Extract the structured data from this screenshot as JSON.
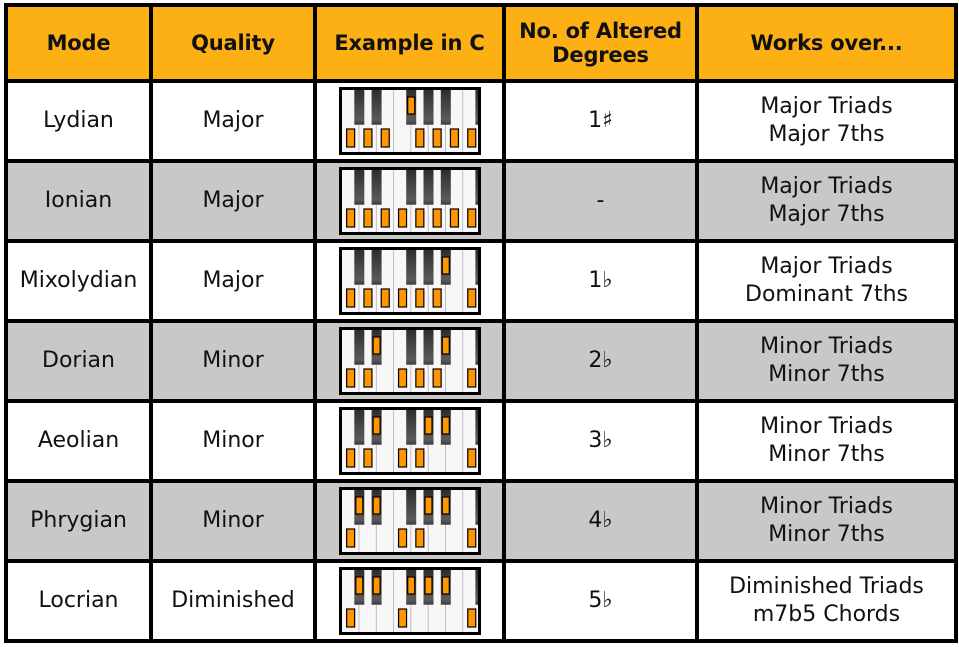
{
  "table": {
    "headers": [
      "Mode",
      "Quality",
      "Example in C",
      "No. of Altered Degrees",
      "Works over..."
    ],
    "header_fill": "#fdb014",
    "stripe_fill": "#c8c8c8",
    "marker_color": "#ff9500",
    "rows": [
      {
        "mode": "Lydian",
        "quality": "Major",
        "altered": "1♯",
        "works": [
          "Major Triads",
          "Major 7ths"
        ],
        "keyboard": {
          "white_marked": [
            "C",
            "D",
            "E",
            "G",
            "A",
            "B",
            "C2"
          ],
          "black_marked": [
            "F#"
          ]
        }
      },
      {
        "mode": "Ionian",
        "quality": "Major",
        "altered": "-",
        "works": [
          "Major Triads",
          "Major 7ths"
        ],
        "keyboard": {
          "white_marked": [
            "C",
            "D",
            "E",
            "F",
            "G",
            "A",
            "B",
            "C2"
          ],
          "black_marked": []
        }
      },
      {
        "mode": "Mixolydian",
        "quality": "Major",
        "altered": "1♭",
        "works": [
          "Major Triads",
          "Dominant 7ths"
        ],
        "keyboard": {
          "white_marked": [
            "C",
            "D",
            "E",
            "F",
            "G",
            "A",
            "C2"
          ],
          "black_marked": [
            "A#"
          ]
        }
      },
      {
        "mode": "Dorian",
        "quality": "Minor",
        "altered": "2♭",
        "works": [
          "Minor Triads",
          "Minor 7ths"
        ],
        "keyboard": {
          "white_marked": [
            "C",
            "D",
            "F",
            "G",
            "A",
            "C2"
          ],
          "black_marked": [
            "D#",
            "A#"
          ]
        }
      },
      {
        "mode": "Aeolian",
        "quality": "Minor",
        "altered": "3♭",
        "works": [
          "Minor Triads",
          "Minor 7ths"
        ],
        "keyboard": {
          "white_marked": [
            "C",
            "D",
            "F",
            "G",
            "C2"
          ],
          "black_marked": [
            "D#",
            "G#",
            "A#"
          ]
        }
      },
      {
        "mode": "Phrygian",
        "quality": "Minor",
        "altered": "4♭",
        "works": [
          "Minor Triads",
          "Minor 7ths"
        ],
        "keyboard": {
          "white_marked": [
            "C",
            "F",
            "G",
            "C2"
          ],
          "black_marked": [
            "C#",
            "D#",
            "G#",
            "A#"
          ]
        }
      },
      {
        "mode": "Locrian",
        "quality": "Diminished",
        "altered": "5♭",
        "works": [
          "Diminished Triads",
          "m7b5 Chords"
        ],
        "keyboard": {
          "white_marked": [
            "C",
            "F",
            "C2"
          ],
          "black_marked": [
            "C#",
            "D#",
            "F#",
            "G#",
            "A#"
          ]
        }
      }
    ]
  }
}
